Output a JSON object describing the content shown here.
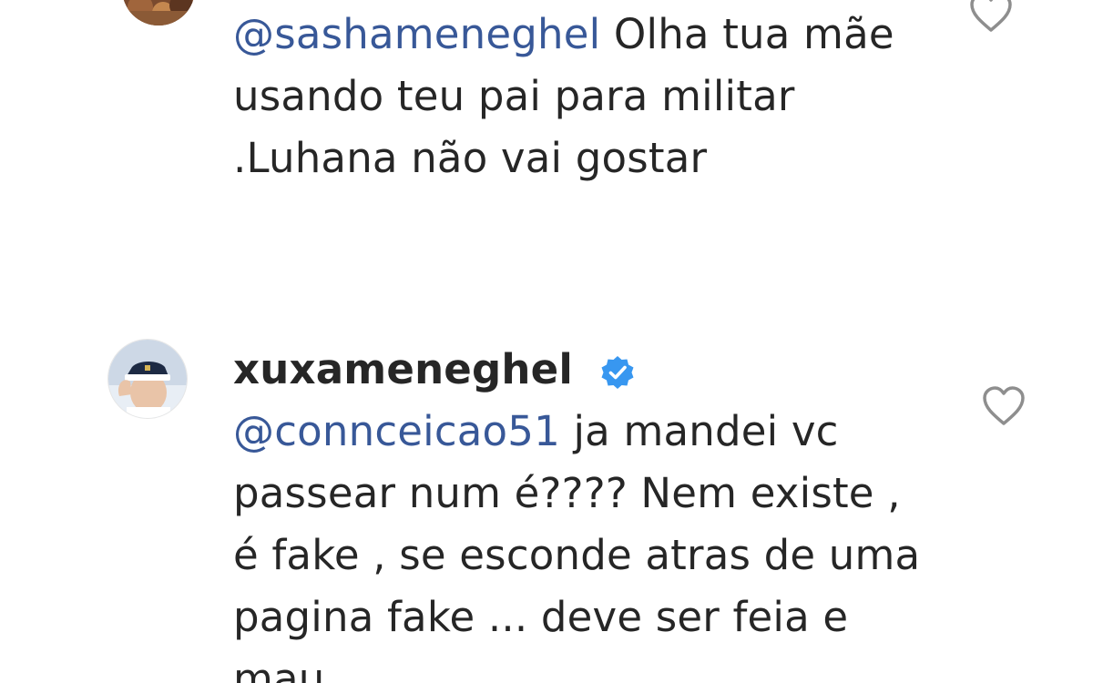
{
  "comments": [
    {
      "mention": "@sashameneghel",
      "text": " Olha tua mãe usando teu pai para militar .Luhana não vai gostar"
    },
    {
      "username": "xuxameneghel",
      "verified": true,
      "mention": "@connceicao51",
      "text": " ja mandei vc passear num é???? Nem existe , é fake , se esconde atras de uma pagina fake ... deve ser feia e mau"
    }
  ],
  "colors": {
    "mention": "#385898",
    "text": "#262626",
    "verified_badge": "#3897f0",
    "heart_outline": "#8e8e8e"
  },
  "icons": {
    "like": "heart-outline-icon",
    "verified": "verified-badge-icon"
  }
}
